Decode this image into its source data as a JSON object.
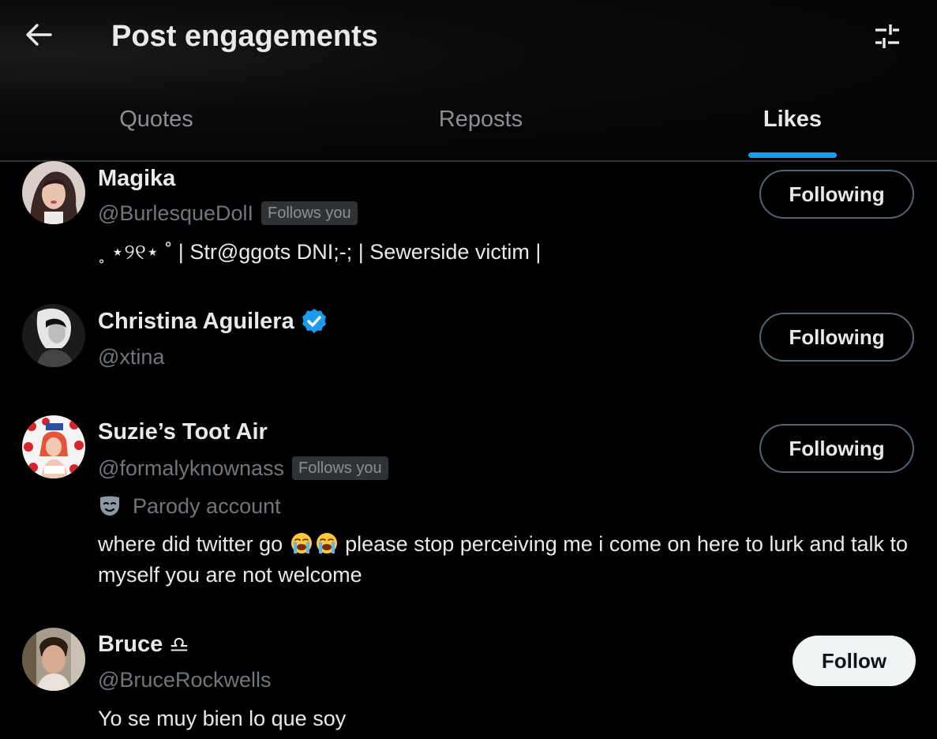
{
  "header": {
    "title": "Post engagements",
    "back_icon": "arrow-left-icon",
    "filter_icon": "sliders-icon"
  },
  "tabs": [
    {
      "label": "Quotes",
      "active": false
    },
    {
      "label": "Reposts",
      "active": false
    },
    {
      "label": "Likes",
      "active": true
    }
  ],
  "colors": {
    "accent": "#1d9bf0",
    "background": "#000000",
    "muted_text": "#71767b",
    "primary_text": "#e7e9ea"
  },
  "users": [
    {
      "name": "Magika",
      "handle": "@BurlesqueDolI",
      "follows_you": "Follows you",
      "bio": "˳ ⋆୨୧⋆ ˚ | Str@ggots DNI;-; | Sewerside victim |",
      "button": "Following"
    },
    {
      "name": "Christina Aguilera",
      "verified": true,
      "handle": "@xtina",
      "button": "Following"
    },
    {
      "name": "Suzie’s Toot Air",
      "handle": "@formalyknownass",
      "follows_you": "Follows you",
      "parody": "Parody account",
      "bio_part1": "where did twitter go ",
      "bio_part2": " please stop perceiving me i come on here to lurk and talk to myself you are not welcome",
      "button": "Following"
    },
    {
      "name": "Bruce",
      "name_symbol": "♎",
      "handle": "@BruceRockwells",
      "bio": "Yo se muy bien lo que soy",
      "button": "Follow"
    }
  ]
}
